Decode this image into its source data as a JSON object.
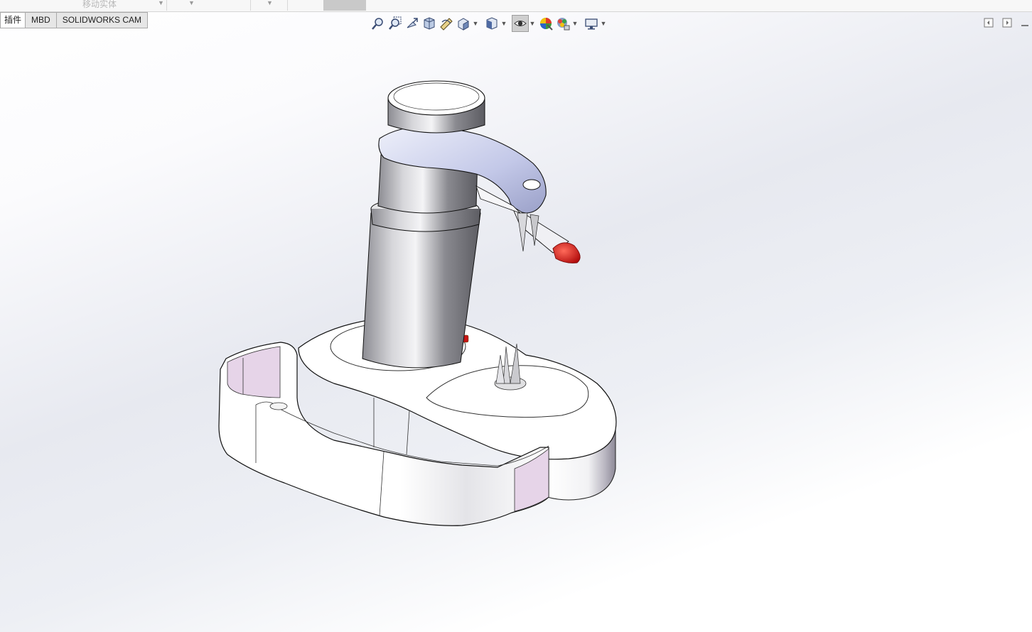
{
  "top_toolbar": {
    "ghost_label": "移动实体"
  },
  "tabs": [
    {
      "label": "插件"
    },
    {
      "label": "MBD"
    },
    {
      "label": "SOLIDWORKS CAM"
    }
  ],
  "heads_up_toolbar": [
    {
      "icon": "zoom-to-fit-icon"
    },
    {
      "icon": "zoom-to-area-icon"
    },
    {
      "icon": "previous-view-icon"
    },
    {
      "icon": "section-view-icon"
    },
    {
      "icon": "dynamic-annotation-icon"
    },
    {
      "icon": "view-orientation-icon"
    },
    {
      "icon": "display-style-icon"
    },
    {
      "icon": "hide-show-items-icon"
    },
    {
      "icon": "edit-appearance-icon"
    },
    {
      "icon": "apply-scene-icon"
    },
    {
      "icon": "view-settings-icon"
    }
  ],
  "colors": {
    "accent_red": "#d41414",
    "pink_panel": "#e6d4e8",
    "bracket_blue": "#c9cde8"
  }
}
